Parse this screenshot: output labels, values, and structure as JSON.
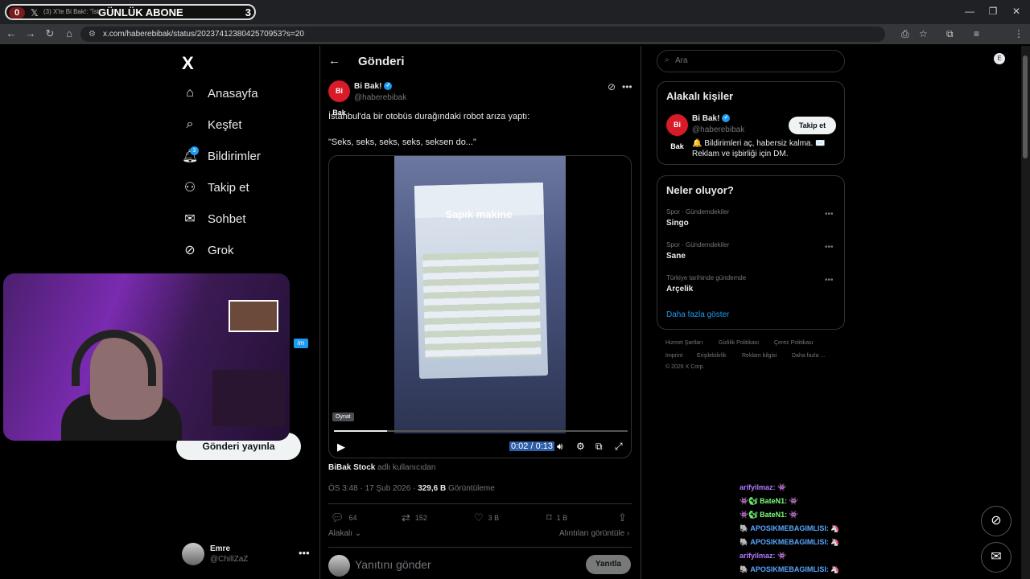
{
  "browser": {
    "tab_count": "0",
    "tab_title": "(3) X'te Bi Bak!: \"İstanbul'da...",
    "tab_overlay_label": "GÜNLÜK ABONE",
    "tab_overlay_num": "3",
    "url": "x.com/haberebibak/status/2023741238042570953?s=20",
    "profile_initial": "E"
  },
  "sidebar": {
    "logo": "X",
    "items": [
      {
        "label": "Anasayfa",
        "icon": "home-icon",
        "glyph": "⌂"
      },
      {
        "label": "Keşfet",
        "icon": "search-icon",
        "glyph": "⌕"
      },
      {
        "label": "Bildirimler",
        "icon": "bell-icon",
        "glyph": "🔔",
        "badge": "3"
      },
      {
        "label": "Takip et",
        "icon": "follow-icon",
        "glyph": "👤"
      },
      {
        "label": "Sohbet",
        "icon": "mail-icon",
        "glyph": "✉"
      },
      {
        "label": "Grok",
        "icon": "grok-icon",
        "glyph": "⊘"
      }
    ],
    "post_button": "Gönderi yayınla",
    "user": {
      "name": "Emre",
      "handle": "@ChillZaZ"
    }
  },
  "post": {
    "page_title": "Gönderi",
    "author_initials": "Bi Bak",
    "author_name": "Bi Bak!",
    "author_handle": "@haberebibak",
    "text_line1": "İstanbul'da bir otobüs durağındaki robot arıza yaptı:",
    "text_line2": "\"Seks, seks, seks, seks, seksen do...\"",
    "video": {
      "caption": "Sapık makine",
      "tooltip": "Oynat",
      "time": "0:02 / 0:13",
      "progress": 0.18
    },
    "source_user": "BiBak Stock",
    "source_suffix": "adlı kullanıcıdan",
    "timestamp": "ÖS 3:48 · 17 Şub 2026 ·",
    "views": "329,6 B",
    "views_label": "Görüntüleme",
    "actions": {
      "replies": "64",
      "reposts": "152",
      "likes": "3 B",
      "bookmarks": "1 B"
    },
    "relevance": "Alakalı",
    "quotes_link": "Alıntıları görüntüle",
    "reply_placeholder": "Yanıtını gönder",
    "reply_button": "Yanıtla"
  },
  "right": {
    "search_placeholder": "Ara",
    "relevant_title": "Alakalı kişiler",
    "relevant_person": {
      "initials": "Bi Bak",
      "name": "Bi Bak!",
      "handle": "@haberebibak",
      "follow": "Takip et",
      "bio": "🔔 Bildirimleri aç, habersiz kalma. ✉️ Reklam ve işbirliği için DM."
    },
    "trends_title": "Neler oluyor?",
    "trends": [
      {
        "category": "Spor · Gündemdekiler",
        "name": "Singo"
      },
      {
        "category": "Spor · Gündemdekiler",
        "name": "Sane"
      },
      {
        "category": "Türkiye tarihinde gündemde",
        "name": "Arçelik"
      }
    ],
    "show_more": "Daha fazla göster",
    "footer_row1": [
      "Hizmet Şartları",
      "Gizlilik Politikası",
      "Çerez Politikası"
    ],
    "footer_row2": [
      "Imprint",
      "Erişilebilirlik",
      "Reklam bilgisi",
      "Daha fazla ..."
    ],
    "copyright": "© 2026 X Corp."
  },
  "chat": [
    {
      "user": "arifyilmaz:",
      "msg": "👾",
      "color": "#b27bff"
    },
    {
      "user": "👾🐿 BateN1:",
      "msg": "👾",
      "color": "#7cff7c"
    },
    {
      "user": "👾🐿 BateN1:",
      "msg": "👾",
      "color": "#7cff7c"
    },
    {
      "user": "🐘 APOSIKMEBAGIMLISI:",
      "msg": "🦄",
      "color": "#5aa6ff"
    },
    {
      "user": "🐘 APOSIKMEBAGIMLISI:",
      "msg": "🦄",
      "color": "#5aa6ff"
    },
    {
      "user": "arifyilmaz:",
      "msg": "👾",
      "color": "#b27bff"
    },
    {
      "user": "🐘 APOSIKMEBAGIMLISI:",
      "msg": "🦄",
      "color": "#5aa6ff"
    }
  ],
  "colors": {
    "accent": "#1d9bf0",
    "brand_red": "#d81b28"
  }
}
